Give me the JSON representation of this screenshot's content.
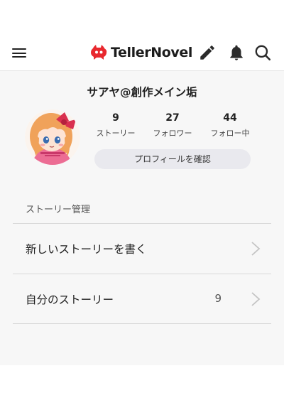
{
  "header": {
    "brand_name": "TellerNovel",
    "icons": [
      "hamburger-menu-icon",
      "tellernovel-logo-icon",
      "pencil-icon",
      "bell-icon",
      "search-icon"
    ],
    "colors": {
      "brand_red": "#e8282e",
      "icon_dark": "#2b2b2b"
    }
  },
  "profile": {
    "username": "サアヤ@創作メイン垢",
    "stats": [
      {
        "value": "9",
        "label": "ストーリー"
      },
      {
        "value": "27",
        "label": "フォロワー"
      },
      {
        "value": "44",
        "label": "フォロー中"
      }
    ],
    "confirm_button": "プロフィールを確認"
  },
  "story_management": {
    "section_label": "ストーリー管理",
    "items": [
      {
        "label": "新しいストーリーを書く",
        "count": ""
      },
      {
        "label": "自分のストーリー",
        "count": "9"
      }
    ]
  }
}
